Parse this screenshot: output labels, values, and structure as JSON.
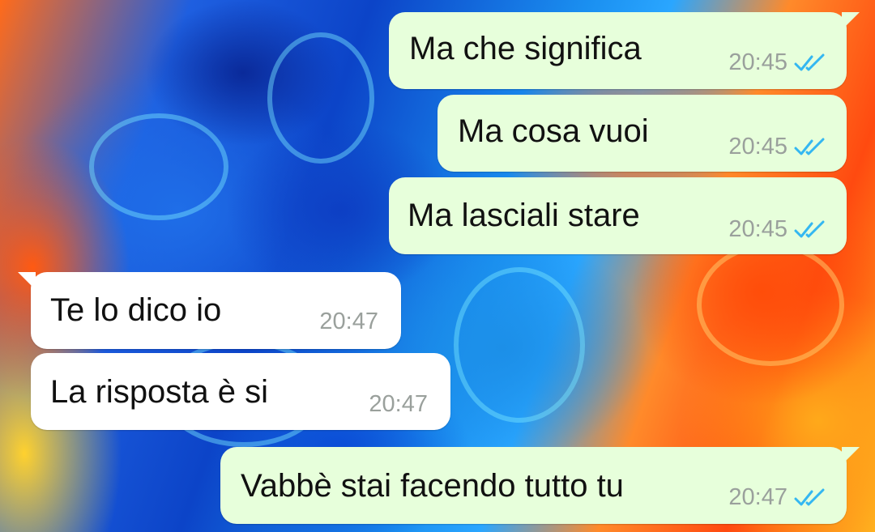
{
  "chat": {
    "messages": [
      {
        "direction": "outgoing",
        "text": "Ma che significa",
        "time": "20:45",
        "status": "read-double-check-icon"
      },
      {
        "direction": "outgoing",
        "text": "Ma cosa vuoi",
        "time": "20:45",
        "status": "read-double-check-icon"
      },
      {
        "direction": "outgoing",
        "text": "Ma lasciali stare",
        "time": "20:45",
        "status": "read-double-check-icon"
      },
      {
        "direction": "incoming",
        "text": "Te lo dico io",
        "time": "20:47"
      },
      {
        "direction": "incoming",
        "text": "La risposta è si",
        "time": "20:47"
      },
      {
        "direction": "outgoing",
        "text": "Vabbè stai facendo tutto tu",
        "time": "20:47",
        "status": "read-double-check-icon"
      }
    ]
  },
  "colors": {
    "outgoing_bubble": "#e7ffdb",
    "incoming_bubble": "#ffffff",
    "timestamp": "#9aa09c",
    "read_ticks": "#34b7f1"
  }
}
